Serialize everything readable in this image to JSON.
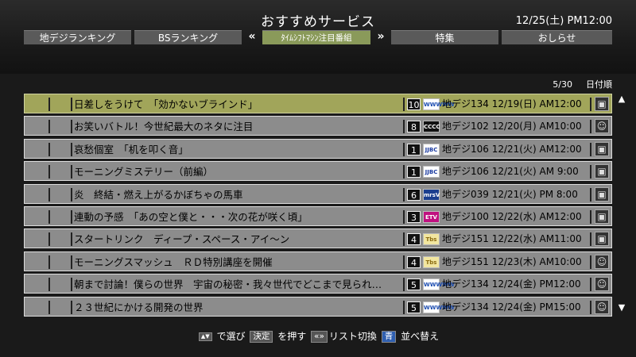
{
  "header": {
    "title": "おすすめサービス",
    "datetime": "12/25(土) PM12:00"
  },
  "tabs": {
    "items": [
      "地デジランキング",
      "BSランキング",
      "ﾀｲﾑｼﾌﾄﾏｼﾝ注目番組",
      "特集",
      "おしらせ"
    ],
    "left_arrow": "«",
    "right_arrow": "»",
    "active_index": 2
  },
  "list": {
    "page": "5/30",
    "sort": "日付順",
    "rows": [
      {
        "title": "日差しをうけて　「効かないブラインド」",
        "ch": "10",
        "logo": "WWWWW",
        "info": "地デジ134  12/19(日)  AM12:00",
        "icon": "photo-icon",
        "selected": true
      },
      {
        "title": "お笑いバトル！今世紀最大のネタに注目",
        "ch": "8",
        "logo": "CCCC",
        "info": "地デジ102  12/20(月)  AM10:00",
        "icon": "face-icon",
        "selected": false
      },
      {
        "title": "哀愁個室　「机を叩く音」",
        "ch": "1",
        "logo": "JJBC",
        "info": "地デジ106  12/21(火)  AM12:00",
        "icon": "photo-icon",
        "selected": false
      },
      {
        "title": "モーニングミステリー（前編）",
        "ch": "1",
        "logo": "JJBC",
        "info": "地デジ106  12/21(火)  AM 9:00",
        "icon": "photo-icon",
        "selected": false
      },
      {
        "title": "炎　終結・燃え上がるかぼちゃの馬車",
        "ch": "6",
        "logo": "mrsV",
        "info": "地デジ039  12/21(火)  PM 8:00",
        "icon": "photo-icon",
        "selected": false
      },
      {
        "title": "連動の予感　「あの空と僕と・・・次の花が咲く頃」",
        "ch": "3",
        "logo": "ETV",
        "info": "地デジ100  12/22(水)  AM12:00",
        "icon": "photo-icon",
        "selected": false
      },
      {
        "title": "スタートリンク　ディープ・スペース・アイ～ン",
        "ch": "4",
        "logo": "Tbs",
        "info": "地デジ151  12/22(水)  AM11:00",
        "icon": "photo-icon",
        "selected": false
      },
      {
        "title": "モーニングスマッシュ　ＲＤ特別講座を開催",
        "ch": "4",
        "logo": "Tbs",
        "info": "地デジ151  12/23(木)  AM10:00",
        "icon": "face-icon",
        "selected": false
      },
      {
        "title": "朝まで討論！僕らの世界　宇宙の秘密・我々世代でどこまで見られ…",
        "ch": "5",
        "logo": "WWWWW",
        "info": "地デジ134  12/24(金)  PM12:00",
        "icon": "face-icon",
        "selected": false
      },
      {
        "title": "２３世紀にかける開発の世界",
        "ch": "5",
        "logo": "WWWWW",
        "info": "地デジ134  12/24(金)  PM15:00",
        "icon": "face-icon",
        "selected": false
      }
    ]
  },
  "footer": {
    "updown_key": "▲▼",
    "select_text": "で選び",
    "enter_key": "決定",
    "press_text": "を押す",
    "switch_keys": "«»",
    "switch_text": "リスト切換",
    "blue_key": "青",
    "sort_text": "並べ替え"
  },
  "colors": {
    "selected_row": "#a1a55a",
    "row": "#8c8c8c",
    "active_tab": "#8a9a5a"
  }
}
